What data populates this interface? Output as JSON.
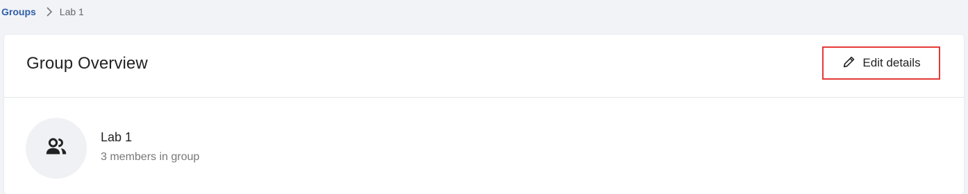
{
  "breadcrumb": {
    "parent": "Groups",
    "current": "Lab 1"
  },
  "header": {
    "title": "Group Overview",
    "edit_label": "Edit details"
  },
  "group": {
    "name": "Lab 1",
    "members_text": "3 members in group"
  },
  "icons": {
    "breadcrumb_separator": "chevron-right-icon",
    "edit": "pencil-icon",
    "avatar": "group-people-icon"
  },
  "colors": {
    "link": "#2f5ea8",
    "highlight_border": "#e53935",
    "page_background": "#f1f3f7"
  }
}
